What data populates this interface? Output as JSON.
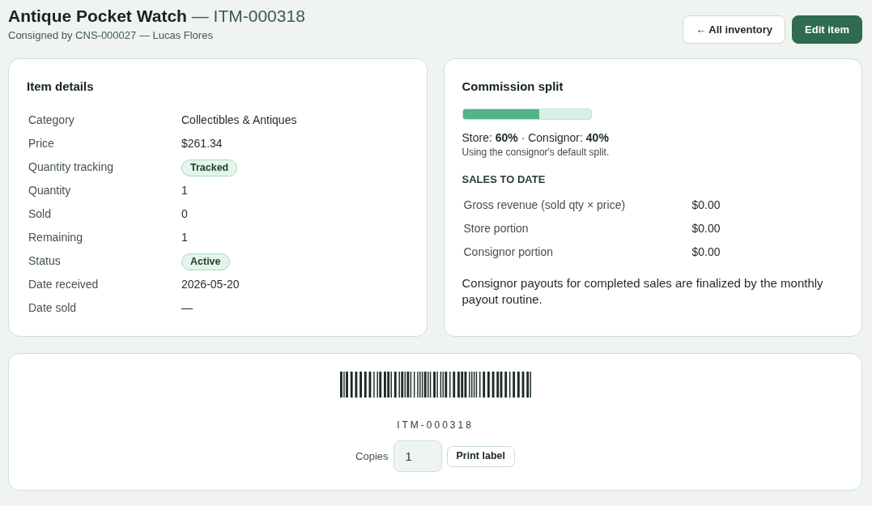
{
  "header": {
    "title": "**Antique Pocket Watch** — ITM-000318",
    "subtitle": "Consigned by CNS-000027 — Lucas Flores",
    "buttons": [
      {
        "label": "← All inventory",
        "kind": "outline"
      },
      {
        "label": "Edit item",
        "kind": "primary"
      }
    ]
  },
  "item_details": {
    "title": "Item details",
    "rows": [
      {
        "label": "Category",
        "value": "Collectibles & Antiques",
        "kind": "text"
      },
      {
        "label": "Price",
        "value": "$261.34",
        "kind": "text"
      },
      {
        "label": "Quantity tracking",
        "value": "Tracked",
        "kind": "badge"
      },
      {
        "label": "Quantity",
        "value": "1",
        "kind": "text"
      },
      {
        "label": "Sold",
        "value": "0",
        "kind": "text"
      },
      {
        "label": "Remaining",
        "value": "1",
        "kind": "text"
      },
      {
        "label": "Status",
        "value": "Active",
        "kind": "badge"
      },
      {
        "label": "Date received",
        "value": "2026-05-20",
        "kind": "text"
      },
      {
        "label": "Date sold",
        "value": "—",
        "kind": "text"
      }
    ]
  },
  "commission_split": {
    "title": "Commission split",
    "level": 0.6,
    "summary": "Store: **60%** · Consignor: **40%**",
    "note": "Using the consignor's default split.",
    "sales_heading": "SALES TO DATE",
    "sales_rows": [
      {
        "label": "Gross revenue (sold qty × price)",
        "value": "$0.00"
      },
      {
        "label": "Store portion",
        "value": "$0.00"
      },
      {
        "label": "Consignor portion",
        "value": "$0.00"
      }
    ],
    "footnote": "Consignor payouts for completed sales are finalized by the monthly payout routine."
  },
  "label_printer": {
    "code": "ITM-000318",
    "copies_label": "Copies",
    "copies_value": "1",
    "button": "Print label"
  }
}
